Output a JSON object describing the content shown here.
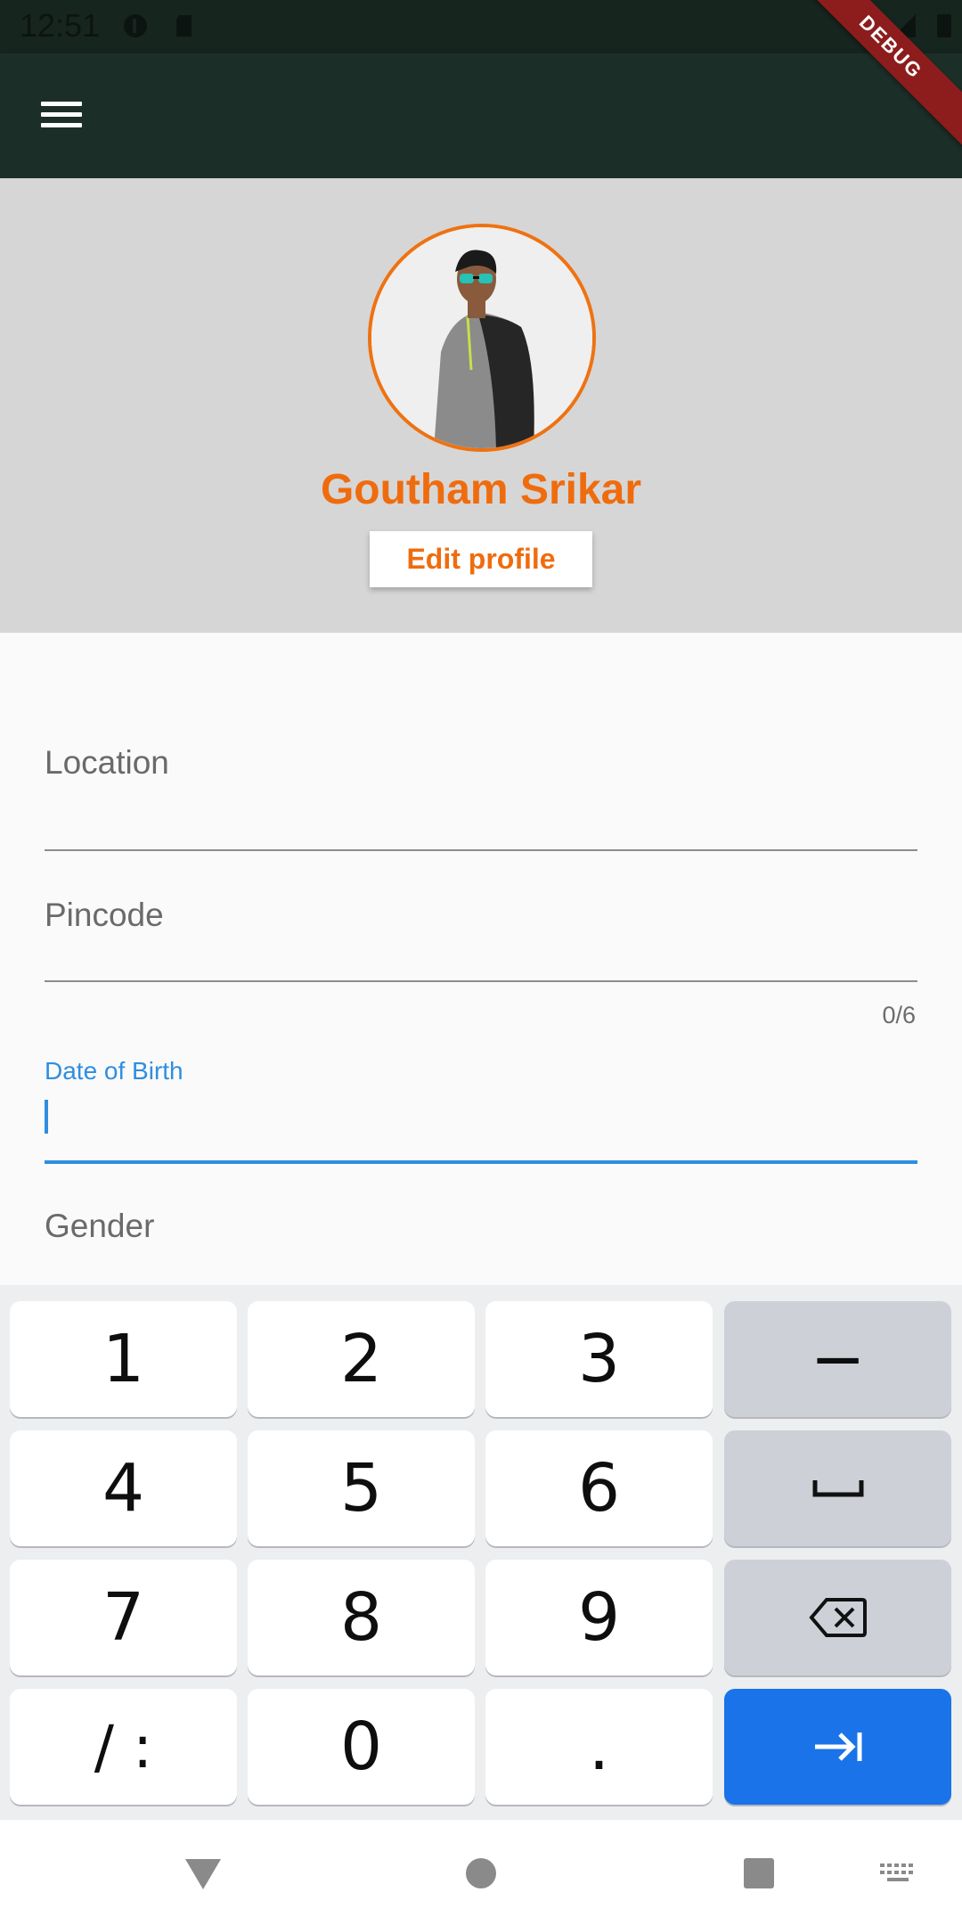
{
  "status_bar": {
    "time": "12:51"
  },
  "debug_banner": "DEBUG",
  "profile": {
    "name": "Goutham Srikar",
    "edit_button": "Edit profile"
  },
  "form": {
    "location_label": "Location",
    "pincode_label": "Pincode",
    "pincode_counter": "0/6",
    "dob_label": "Date of Birth",
    "gender_label": "Gender"
  },
  "keyboard": {
    "keys": [
      "1",
      "2",
      "3",
      "−",
      "4",
      "5",
      "6",
      "7",
      "8",
      "9",
      "/ :",
      "0",
      "."
    ]
  },
  "colors": {
    "accent_orange": "#ef6c0e",
    "focus_blue": "#2f8ee0",
    "app_bar": "#1c2e28",
    "keyboard_action": "#1a73e8"
  }
}
